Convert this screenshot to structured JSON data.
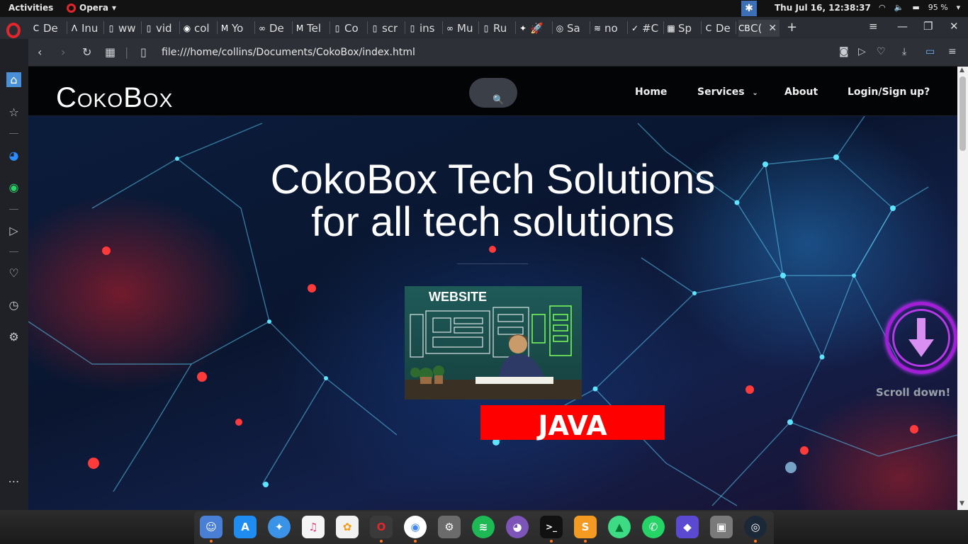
{
  "system_bar": {
    "activities": "Activities",
    "app_name": "Opera",
    "clock": "Thu Jul 16, 12:38:37",
    "battery": "95 %"
  },
  "browser": {
    "tabs": [
      {
        "favicon": "C",
        "label": "De"
      },
      {
        "favicon": "Λ",
        "label": "Inu"
      },
      {
        "favicon": "▯",
        "label": "ww"
      },
      {
        "favicon": "▯",
        "label": "vid"
      },
      {
        "favicon": "◉",
        "label": "col"
      },
      {
        "favicon": "M",
        "label": "Yo"
      },
      {
        "favicon": "∞",
        "label": "De"
      },
      {
        "favicon": "M",
        "label": "Tel"
      },
      {
        "favicon": "▯",
        "label": "Co"
      },
      {
        "favicon": "▯",
        "label": "scr"
      },
      {
        "favicon": "▯",
        "label": "ins"
      },
      {
        "favicon": "∞",
        "label": "Mu"
      },
      {
        "favicon": "▯",
        "label": "Ru"
      },
      {
        "favicon": "✦",
        "label": "🚀"
      },
      {
        "favicon": "◎",
        "label": "Sa"
      },
      {
        "favicon": "≋",
        "label": "no"
      },
      {
        "favicon": "✓",
        "label": "#C"
      },
      {
        "favicon": "▦",
        "label": "Sp"
      },
      {
        "favicon": "C",
        "label": "De"
      },
      {
        "favicon": "CB",
        "label": "C("
      }
    ],
    "url": "file:///home/collins/Documents/CokoBox/index.html"
  },
  "site": {
    "logo": "CokoBox",
    "nav": {
      "home": "Home",
      "services": "Services",
      "about": "About",
      "login": "Login/Sign up?"
    },
    "hero": {
      "title_line1": "CokoBox Tech Solutions",
      "title_line2": "for all tech solutions",
      "image_caption": "WEBSITE",
      "banner": "JAVA",
      "scroll_label": "Scroll down!"
    }
  },
  "colors": {
    "banner_red": "#ff0000",
    "scroll_purple": "#a21fd6",
    "arrow_violet": "#d98ef2",
    "opera_red": "#e3262b"
  }
}
